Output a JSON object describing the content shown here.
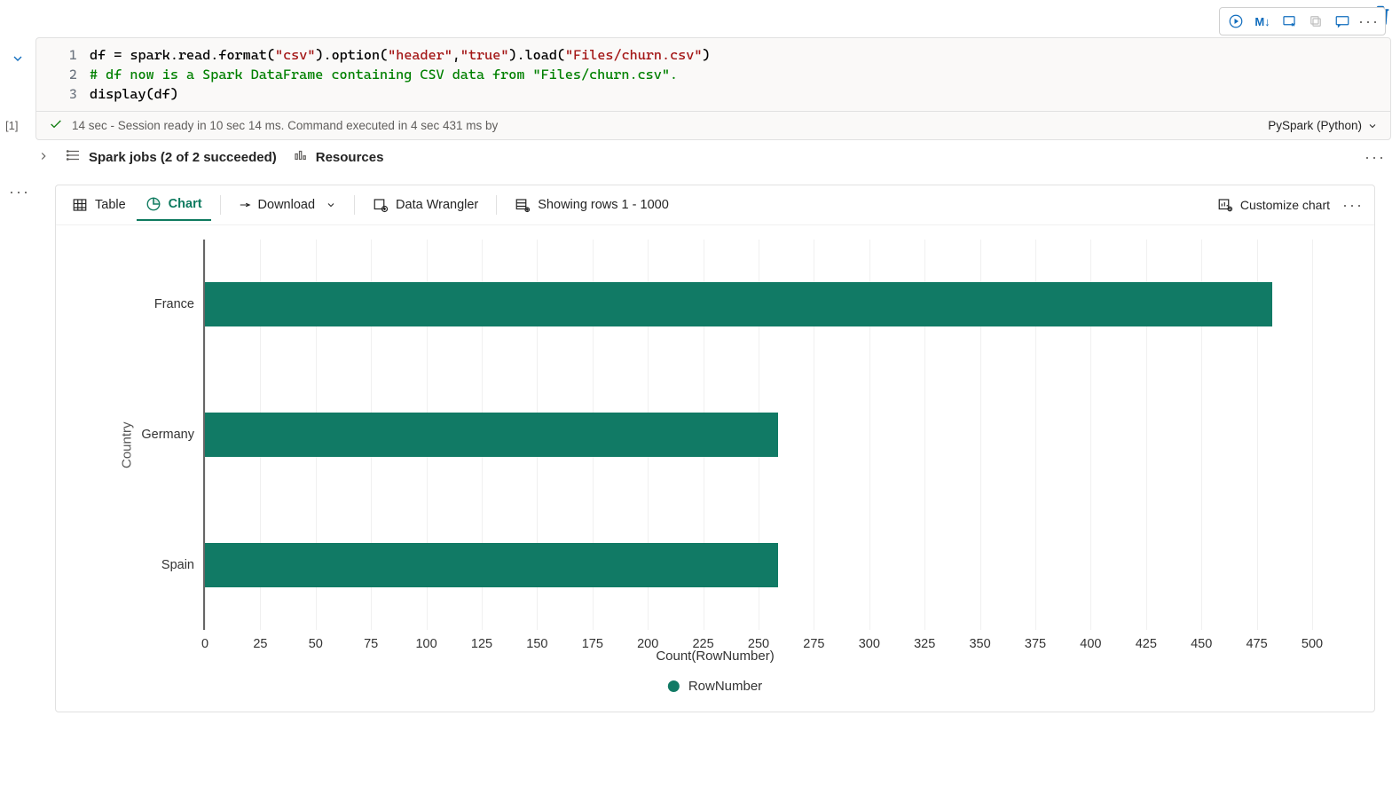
{
  "toolbar": {
    "markdown_label": "M↓"
  },
  "code": {
    "lines": [
      "df = spark.read.format(\"csv\").option(\"header\",\"true\").load(\"Files/churn.csv\")",
      "# df now is a Spark DataFrame containing CSV data from \"Files/churn.csv\".",
      "display(df)"
    ],
    "gutter": [
      "1",
      "2",
      "3"
    ]
  },
  "status": {
    "cell_label": "[1]",
    "duration": "14 sec",
    "message": "Session ready in 10 sec 14 ms. Command executed in 4 sec 431 ms by",
    "language": "PySpark (Python)"
  },
  "jobs_row": {
    "spark_jobs": "Spark jobs (2 of 2 succeeded)",
    "resources": "Resources"
  },
  "output_toolbar": {
    "table": "Table",
    "chart": "Chart",
    "download": "Download",
    "data_wrangler": "Data Wrangler",
    "rows": "Showing rows 1 - 1000",
    "customize": "Customize chart"
  },
  "chart_data": {
    "type": "bar",
    "orientation": "horizontal",
    "categories": [
      "France",
      "Germany",
      "Spain"
    ],
    "values": [
      482,
      259,
      259
    ],
    "xlabel": "Count(RowNumber)",
    "ylabel": "Country",
    "xlim": [
      0,
      500
    ],
    "xticks": [
      0,
      25,
      50,
      75,
      100,
      125,
      150,
      175,
      200,
      225,
      250,
      275,
      300,
      325,
      350,
      375,
      400,
      425,
      450,
      475,
      500
    ],
    "legend": "RowNumber"
  }
}
